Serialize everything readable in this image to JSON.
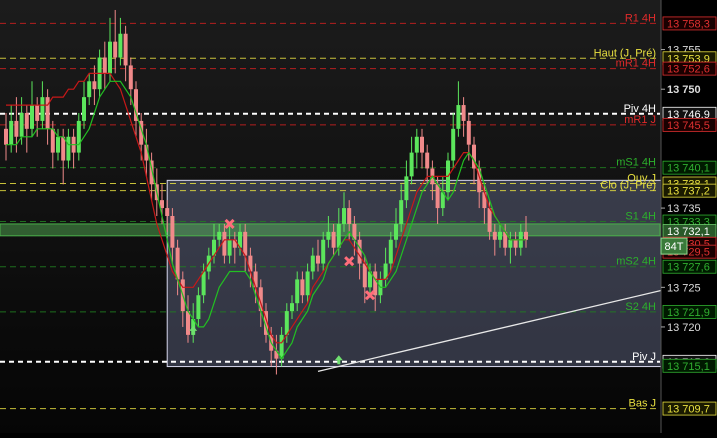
{
  "chart_data": {
    "type": "candlestick",
    "instrument_badge": "84T",
    "y_axis": {
      "range": [
        13707.5,
        13760.5
      ],
      "ticks": [
        {
          "value": 13758.3,
          "label": "13 758,3",
          "kind": "box",
          "bg": "#1a0000",
          "fg": "#e03030"
        },
        {
          "value": 13755,
          "label": "13 755",
          "kind": "plain"
        },
        {
          "value": 13753.9,
          "label": "13 753,9",
          "kind": "box",
          "bg": "#1a1a00",
          "fg": "#e8e040"
        },
        {
          "value": 13752.6,
          "label": "13 752,6",
          "kind": "box",
          "bg": "#1a0000",
          "fg": "#e03030"
        },
        {
          "value": 13750,
          "label": "13 750",
          "kind": "bold"
        },
        {
          "value": 13746.9,
          "label": "13 746,9",
          "kind": "box",
          "bg": "#111",
          "fg": "#ffffff"
        },
        {
          "value": 13745.5,
          "label": "13 745,5",
          "kind": "box",
          "bg": "#1a0000",
          "fg": "#e03030"
        },
        {
          "value": 13740.1,
          "label": "13 740,1",
          "kind": "box",
          "bg": "#001a00",
          "fg": "#30b030"
        },
        {
          "value": 13738.1,
          "label": "13 738,1",
          "kind": "box",
          "bg": "#1a1a00",
          "fg": "#e8e040"
        },
        {
          "value": 13737.2,
          "label": "13 737,2",
          "kind": "box",
          "bg": "#1a1a00",
          "fg": "#e8e040"
        },
        {
          "value": 13735,
          "label": "13 735",
          "kind": "plain"
        },
        {
          "value": 13733.3,
          "label": "13 733,3",
          "kind": "box",
          "bg": "#001a00",
          "fg": "#30b030"
        },
        {
          "value": 13732.1,
          "label": "13 732,1",
          "kind": "current",
          "bg": "#2a5a2a",
          "fg": "#ffffff"
        },
        {
          "value": 13730.5,
          "label": "13 730,5",
          "kind": "box",
          "bg": "#1a0000",
          "fg": "#e03030"
        },
        {
          "value": 13729.5,
          "label": "13 729,5",
          "kind": "box",
          "bg": "#1a0000",
          "fg": "#e03030"
        },
        {
          "value": 13727.6,
          "label": "13 727,6",
          "kind": "box",
          "bg": "#001a00",
          "fg": "#30b030"
        },
        {
          "value": 13725,
          "label": "13 725",
          "kind": "plain"
        },
        {
          "value": 13721.9,
          "label": "13 721,9",
          "kind": "box",
          "bg": "#001a00",
          "fg": "#30b030"
        },
        {
          "value": 13720,
          "label": "13 720",
          "kind": "plain"
        },
        {
          "value": 13715.6,
          "label": "13 715,6",
          "kind": "box",
          "bg": "#111",
          "fg": "#ffffff"
        },
        {
          "value": 13715.1,
          "label": "13 715,1",
          "kind": "box",
          "bg": "#001a00",
          "fg": "#30b030"
        },
        {
          "value": 13709.7,
          "label": "13 709,7",
          "kind": "box",
          "bg": "#1a1a00",
          "fg": "#e8e040"
        }
      ]
    },
    "levels": [
      {
        "name": "R1 4H",
        "value": 13758.3,
        "color": "#d02020",
        "style": "dash"
      },
      {
        "name": "Haut (J, Pré)",
        "value": 13753.9,
        "color": "#e8e040",
        "style": "dash"
      },
      {
        "name": "mR1 4H",
        "value": 13752.6,
        "color": "#d02020",
        "style": "dash"
      },
      {
        "name": "Piv 4H",
        "value": 13746.9,
        "color": "#ffffff",
        "style": "dash-thick"
      },
      {
        "name": "mR1 J",
        "value": 13745.5,
        "color": "#d02020",
        "style": "dash"
      },
      {
        "name": "mS1 4H",
        "value": 13740.1,
        "color": "#208020",
        "style": "dash"
      },
      {
        "name": "Ouv J",
        "value": 13738.1,
        "color": "#e8e040",
        "style": "dash"
      },
      {
        "name": "Clo (J, Pré)",
        "value": 13737.2,
        "color": "#e8e040",
        "style": "dash"
      },
      {
        "name": "S1 4H",
        "value": 13733.3,
        "color": "#208020",
        "style": "dash"
      },
      {
        "name": "mS2 4H",
        "value": 13727.6,
        "color": "#208020",
        "style": "dash"
      },
      {
        "name": "S2 4H",
        "value": 13721.9,
        "color": "#208020",
        "style": "dash"
      },
      {
        "name": "Piv J",
        "value": 13715.6,
        "color": "#ffffff",
        "style": "dash-thick"
      },
      {
        "name": "Bas J",
        "value": 13709.7,
        "color": "#e8e040",
        "style": "dash"
      }
    ],
    "price_band": [
      13731.5,
      13733.0
    ],
    "range_box": {
      "bar_start": 31,
      "bar_end": 183,
      "low": 13715.0,
      "high": 13738.5
    },
    "trendline": {
      "x1_bar": 60,
      "y1": 13714.4,
      "x2_bar": 190,
      "y2": 13734.5
    },
    "candles": [
      [
        13745,
        13743,
        13747,
        13741
      ],
      [
        13743,
        13746,
        13748,
        13742
      ],
      [
        13746,
        13744,
        13749,
        13742
      ],
      [
        13744,
        13747,
        13749,
        13743
      ],
      [
        13747,
        13745,
        13748,
        13742
      ],
      [
        13745,
        13748,
        13751,
        13744
      ],
      [
        13748,
        13746,
        13749,
        13744
      ],
      [
        13746,
        13749,
        13751,
        13745
      ],
      [
        13749,
        13745,
        13750,
        13743
      ],
      [
        13745,
        13742,
        13746,
        13740
      ],
      [
        13742,
        13744,
        13745,
        13741
      ],
      [
        13744,
        13741,
        13745,
        13738
      ],
      [
        13741,
        13744,
        13745,
        13740
      ],
      [
        13744,
        13742,
        13745,
        13740
      ],
      [
        13742,
        13746,
        13747,
        13741
      ],
      [
        13746,
        13749,
        13751,
        13745
      ],
      [
        13749,
        13751,
        13752,
        13748
      ],
      [
        13751,
        13750,
        13753,
        13748
      ],
      [
        13750,
        13754,
        13755,
        13749
      ],
      [
        13754,
        13752,
        13756,
        13750
      ],
      [
        13752,
        13756,
        13759,
        13751
      ],
      [
        13756,
        13754,
        13760,
        13752
      ],
      [
        13754,
        13757,
        13759,
        13753
      ],
      [
        13757,
        13753,
        13758,
        13751
      ],
      [
        13753,
        13750,
        13754,
        13748
      ],
      [
        13750,
        13746,
        13751,
        13744
      ],
      [
        13746,
        13743,
        13747,
        13741
      ],
      [
        13743,
        13741,
        13745,
        13739
      ],
      [
        13741,
        13738,
        13742,
        13736
      ],
      [
        13738,
        13736,
        13740,
        13734
      ],
      [
        13736,
        13735,
        13738,
        13733
      ],
      [
        13735,
        13734,
        13736,
        13732
      ],
      [
        13734,
        13730,
        13735,
        13728
      ],
      [
        13730,
        13726,
        13731,
        13724
      ],
      [
        13726,
        13722,
        13727,
        13720
      ],
      [
        13722,
        13719,
        13724,
        13718
      ],
      [
        13719,
        13721,
        13723,
        13718
      ],
      [
        13721,
        13724,
        13725,
        13720
      ],
      [
        13724,
        13727,
        13728,
        13723
      ],
      [
        13727,
        13729,
        13730,
        13726
      ],
      [
        13729,
        13731,
        13733,
        13728
      ],
      [
        13731,
        13732,
        13733,
        13730
      ],
      [
        13732,
        13729,
        13733,
        13728
      ],
      [
        13729,
        13731,
        13733,
        13728
      ],
      [
        13731,
        13730,
        13732,
        13728
      ],
      [
        13730,
        13732,
        13733,
        13729
      ],
      [
        13732,
        13729,
        13733,
        13727
      ],
      [
        13729,
        13727,
        13730,
        13725
      ],
      [
        13727,
        13725,
        13728,
        13723
      ],
      [
        13725,
        13722,
        13726,
        13720
      ],
      [
        13722,
        13719,
        13723,
        13718
      ],
      [
        13719,
        13717,
        13720,
        13715
      ],
      [
        13717,
        13716,
        13719,
        13714
      ],
      [
        13716,
        13719,
        13720,
        13715
      ],
      [
        13719,
        13722,
        13723,
        13718
      ],
      [
        13722,
        13723,
        13724,
        13721
      ],
      [
        13723,
        13726,
        13727,
        13722
      ],
      [
        13726,
        13724,
        13727,
        13723
      ],
      [
        13724,
        13727,
        13728,
        13723
      ],
      [
        13727,
        13729,
        13730,
        13726
      ],
      [
        13729,
        13728,
        13731,
        13727
      ],
      [
        13728,
        13731,
        13732,
        13727
      ],
      [
        13731,
        13732,
        13734,
        13730
      ],
      [
        13732,
        13730,
        13733,
        13729
      ],
      [
        13730,
        13733,
        13735,
        13729
      ],
      [
        13733,
        13735,
        13737,
        13732
      ],
      [
        13735,
        13733,
        13736,
        13731
      ],
      [
        13733,
        13731,
        13734,
        13729
      ],
      [
        13731,
        13728,
        13732,
        13726
      ],
      [
        13728,
        13725,
        13729,
        13723
      ],
      [
        13725,
        13727,
        13728,
        13724
      ],
      [
        13727,
        13724,
        13728,
        13722
      ],
      [
        13724,
        13726,
        13727,
        13723
      ],
      [
        13726,
        13728,
        13730,
        13725
      ],
      [
        13728,
        13731,
        13732,
        13727
      ],
      [
        13731,
        13733,
        13735,
        13730
      ],
      [
        13733,
        13736,
        13738,
        13732
      ],
      [
        13736,
        13739,
        13741,
        13735
      ],
      [
        13739,
        13742,
        13744,
        13738
      ],
      [
        13742,
        13744,
        13745,
        13740
      ],
      [
        13744,
        13742,
        13745,
        13740
      ],
      [
        13742,
        13740,
        13743,
        13738
      ],
      [
        13740,
        13738,
        13741,
        13736
      ],
      [
        13738,
        13735,
        13739,
        13733
      ],
      [
        13735,
        13737,
        13739,
        13734
      ],
      [
        13737,
        13741,
        13742,
        13736
      ],
      [
        13741,
        13745,
        13747,
        13740
      ],
      [
        13745,
        13748,
        13751,
        13744
      ],
      [
        13748,
        13746,
        13749,
        13744
      ],
      [
        13746,
        13743,
        13747,
        13741
      ],
      [
        13743,
        13740,
        13744,
        13738
      ],
      [
        13740,
        13737,
        13741,
        13735
      ],
      [
        13737,
        13735,
        13738,
        13733
      ],
      [
        13735,
        13732,
        13736,
        13731
      ],
      [
        13732,
        13731,
        13733,
        13729
      ],
      [
        13731,
        13732,
        13733,
        13730
      ],
      [
        13732,
        13730,
        13733,
        13729
      ],
      [
        13730,
        13731,
        13732,
        13728
      ],
      [
        13731,
        13730,
        13732,
        13729
      ],
      [
        13730,
        13732,
        13733,
        13729
      ],
      [
        13732,
        13731,
        13734,
        13730
      ]
    ],
    "ma_red": [
      13748,
      13748,
      13748,
      13748,
      13748,
      13748,
      13748,
      13748,
      13748,
      13749,
      13749,
      13749,
      13750,
      13750,
      13751,
      13751,
      13752,
      13752,
      13752,
      13752,
      13752,
      13751,
      13750,
      13748,
      13746,
      13744,
      13742,
      13739,
      13736,
      13733,
      13731,
      13729,
      13727,
      13726,
      13725,
      13725,
      13725,
      13726,
      13727,
      13728,
      13729,
      13730,
      13731,
      13731,
      13731,
      13730,
      13729,
      13727,
      13725,
      13723,
      13721,
      13719,
      13718,
      13718,
      13719,
      13720,
      13721,
      13722,
      13723,
      13725,
      13726,
      13727,
      13728,
      13729,
      13730,
      13731,
      13731,
      13730,
      13729,
      13728,
      13727,
      13726,
      13726,
      13726,
      13727,
      13729,
      13731,
      13733,
      13735,
      13737,
      13738,
      13739,
      13739,
      13739,
      13739,
      13739,
      13740,
      13741,
      13742,
      13742,
      13741,
      13739,
      13737,
      13735,
      13734,
      13733,
      13732,
      13731,
      13731,
      13731,
      13731
    ],
    "ma_green": [
      13743,
      13743,
      13743,
      13744,
      13744,
      13744,
      13745,
      13745,
      13745,
      13745,
      13744,
      13744,
      13743,
      13743,
      13743,
      13744,
      13745,
      13747,
      13749,
      13750,
      13751,
      13751,
      13751,
      13750,
      13749,
      13747,
      13745,
      13743,
      13740,
      13737,
      13734,
      13731,
      13728,
      13726,
      13724,
      13722,
      13721,
      13720,
      13720,
      13721,
      13723,
      13725,
      13726,
      13727,
      13727,
      13727,
      13727,
      13726,
      13724,
      13722,
      13720,
      13718,
      13717,
      13716,
      13717,
      13718,
      13720,
      13721,
      13722,
      13724,
      13725,
      13726,
      13728,
      13729,
      13730,
      13731,
      13732,
      13731,
      13730,
      13729,
      13727,
      13726,
      13725,
      13725,
      13726,
      13727,
      13729,
      13731,
      13733,
      13735,
      13737,
      13738,
      13739,
      13738,
      13737,
      13736,
      13737,
      13739,
      13741,
      13742,
      13741,
      13740,
      13738,
      13736,
      13734,
      13733,
      13732,
      13731,
      13731,
      13731,
      13731
    ],
    "markers": [
      {
        "bar": 43,
        "value": 13733.0,
        "type": "x"
      },
      {
        "bar": 66,
        "value": 13728.3,
        "type": "x"
      },
      {
        "bar": 70,
        "value": 13724.0,
        "type": "x"
      },
      {
        "bar": 160,
        "value": 13744.5,
        "type": "x"
      },
      {
        "bar": 36,
        "value": 13719.5,
        "type": "arrow-up"
      },
      {
        "bar": 64,
        "value": 13715.8,
        "type": "arrow-up"
      }
    ]
  }
}
